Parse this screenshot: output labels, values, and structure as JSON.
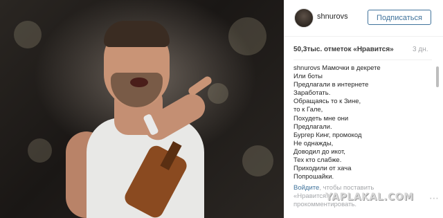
{
  "header": {
    "username": "shnurovs",
    "follow_label": "Подписаться"
  },
  "stats": {
    "likes": "50,3тыс. отметок «Нравится»",
    "time": "3 дн."
  },
  "caption": {
    "author": "shnurovs",
    "lines": [
      "Мамочки в декрете",
      "Или боты",
      "Предлагали в интернете",
      "Заработать.",
      "Обращаясь то к Зине,",
      "то к Гале,",
      "Похудеть мне они",
      "Предлагали.",
      "Бургер Кинг, промокод",
      "Не однажды,",
      "Доводил до икот,",
      "Тех кто слабже.",
      "Приходили от хача",
      "Попрошайки."
    ]
  },
  "login": {
    "link": "Войдите",
    "text1": ", чтобы поставить",
    "text2": "«Нравится»",
    "text3": "прокомментировать."
  },
  "watermark": "YAPLAKAL.COM",
  "icons": {
    "more": "more-dots-icon",
    "avatar": "avatar-image"
  },
  "colors": {
    "accent": "#3f729b",
    "text": "#262626",
    "muted": "#a5a7aa"
  }
}
